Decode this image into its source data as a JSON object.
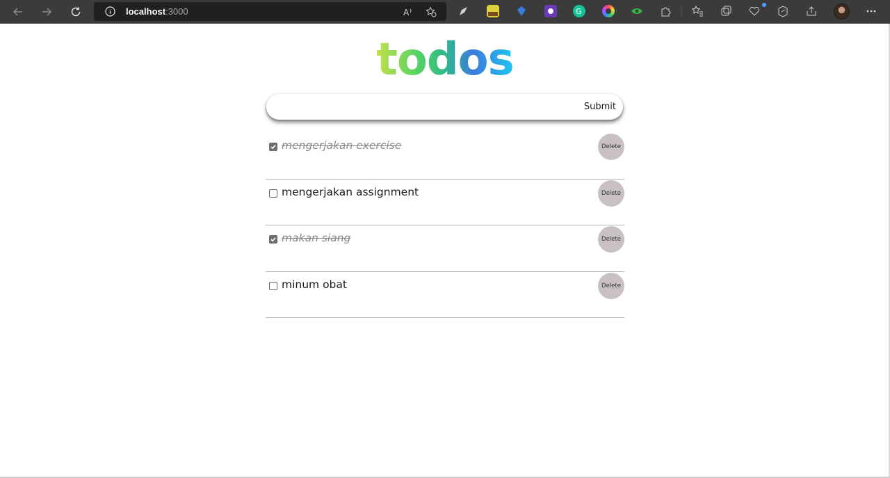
{
  "browser": {
    "url_host": "localhost",
    "url_port": ":3000",
    "accent": "#3b3b3b"
  },
  "app": {
    "title": "todos",
    "input_placeholder": "",
    "submit_label": "Submit",
    "delete_label": "Delete",
    "todos": [
      {
        "text": "mengerjakan exercise",
        "completed": true
      },
      {
        "text": "mengerjakan assignment",
        "completed": false
      },
      {
        "text": "makan siang",
        "completed": true
      },
      {
        "text": "minum obat",
        "completed": false
      }
    ]
  },
  "colors": {
    "title_gradient": [
      "#c6e04a",
      "#56d364",
      "#2fb98a",
      "#3b7bdc",
      "#1fc6f0"
    ],
    "delete_button": "#c9c1c1",
    "done_text": "#8a8a8a"
  }
}
